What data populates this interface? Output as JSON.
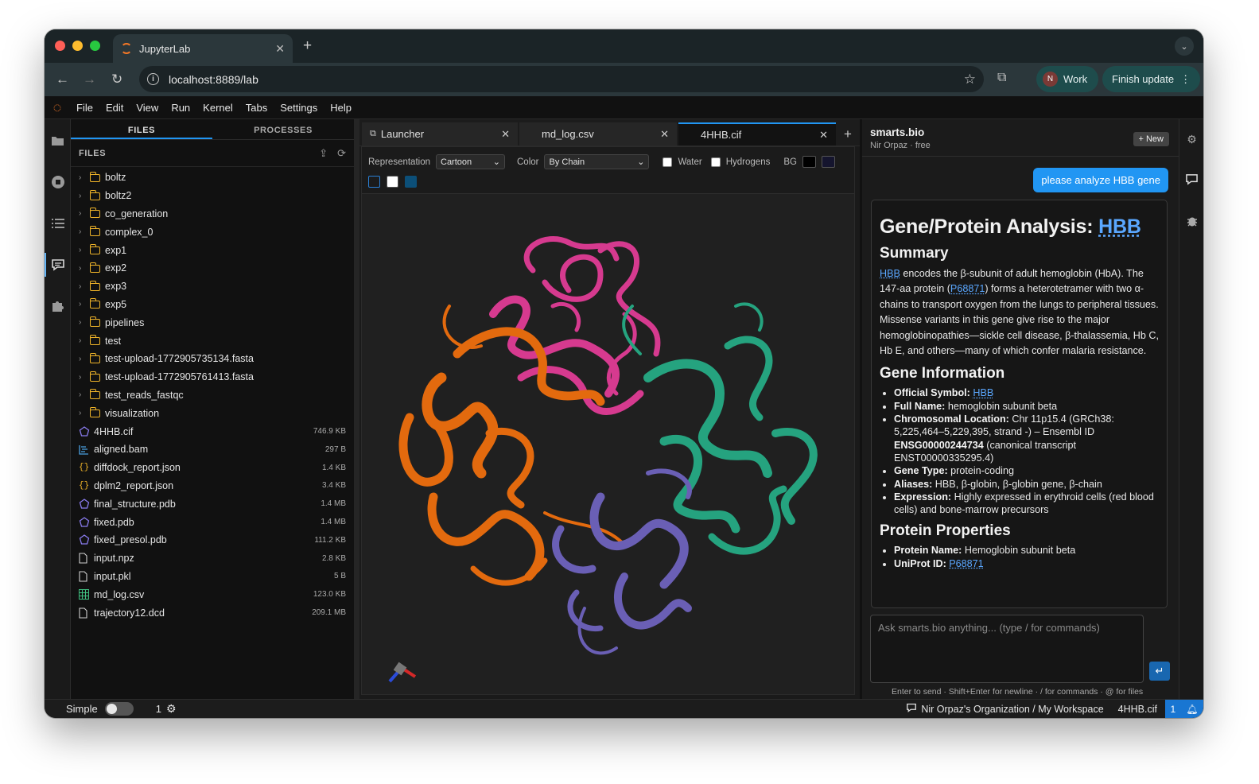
{
  "browser": {
    "tab_title": "JupyterLab",
    "url": "localhost:8889/lab",
    "profile_initial": "N",
    "profile_name": "Work",
    "update_label": "Finish update"
  },
  "menu": [
    "File",
    "Edit",
    "View",
    "Run",
    "Kernel",
    "Tabs",
    "Settings",
    "Help"
  ],
  "file_panel": {
    "tabs": [
      "FILES",
      "PROCESSES"
    ],
    "header": "FILES",
    "folders": [
      "boltz",
      "boltz2",
      "co_generation",
      "complex_0",
      "exp1",
      "exp2",
      "exp3",
      "exp5",
      "pipelines",
      "test",
      "test-upload-1772905735134.fasta",
      "test-upload-1772905761413.fasta",
      "test_reads_fastqc",
      "visualization"
    ],
    "files": [
      {
        "name": "4HHB.cif",
        "size": "746.9 KB",
        "icon": "molecule-icon"
      },
      {
        "name": "aligned.bam",
        "size": "297 B",
        "icon": "alignment-icon"
      },
      {
        "name": "diffdock_report.json",
        "size": "1.4 KB",
        "icon": "json-icon"
      },
      {
        "name": "dplm2_report.json",
        "size": "3.4 KB",
        "icon": "json-icon"
      },
      {
        "name": "final_structure.pdb",
        "size": "1.4 MB",
        "icon": "molecule-icon"
      },
      {
        "name": "fixed.pdb",
        "size": "1.4 MB",
        "icon": "molecule-icon"
      },
      {
        "name": "fixed_presol.pdb",
        "size": "111.2 KB",
        "icon": "molecule-icon"
      },
      {
        "name": "input.npz",
        "size": "2.8 KB",
        "icon": "file-icon"
      },
      {
        "name": "input.pkl",
        "size": "5 B",
        "icon": "file-icon"
      },
      {
        "name": "md_log.csv",
        "size": "123.0 KB",
        "icon": "spreadsheet-icon"
      },
      {
        "name": "trajectory12.dcd",
        "size": "209.1 MB",
        "icon": "file-icon"
      }
    ]
  },
  "doc_tabs": [
    {
      "label": "Launcher",
      "active": false
    },
    {
      "label": "md_log.csv",
      "active": false
    },
    {
      "label": "4HHB.cif",
      "active": true
    }
  ],
  "viewer": {
    "representation_label": "Representation",
    "representation_value": "Cartoon",
    "color_label": "Color",
    "color_value": "By Chain",
    "water_label": "Water",
    "hydrogens_label": "Hydrogens",
    "bg_label": "BG",
    "chain_colors": [
      "#d63a8f",
      "#e36a0e",
      "#25a37f",
      "#6a5fb5"
    ]
  },
  "assistant": {
    "title": "smarts.bio",
    "subtitle": "Nir Orpaz · free",
    "new_label": "+ New",
    "user_message": "please analyze HBB gene",
    "h1_prefix": "Gene/Protein Analysis: ",
    "h1_link": "HBB",
    "summary_heading": "Summary",
    "summary_link": "HBB",
    "summary_part1": " encodes the β-subunit of adult hemoglobin (HbA). The 147-aa protein (",
    "summary_uniprot": "P68871",
    "summary_part2": ") forms a heterotetramer with two α-chains to transport oxygen from the lungs to peripheral tissues. Missense variants in this gene give rise to the major hemoglobinopathies—sickle cell disease, β-thalassemia, Hb C, Hb E, and others—many of which confer malaria resistance.",
    "gene_heading": "Gene Information",
    "gene_items": [
      {
        "label": "Official Symbol:",
        "value": "HBB",
        "link": true
      },
      {
        "label": "Full Name:",
        "value": " hemoglobin subunit beta"
      },
      {
        "label": "Chromosomal Location:",
        "value": " Chr 11p15.4 (GRCh38: 5,225,464–5,229,395, strand -) – Ensembl ID "
      },
      {
        "label": "Gene Type:",
        "value": " protein-coding"
      },
      {
        "label": "Aliases:",
        "value": " HBB, β-globin, β-globin gene, β-chain"
      },
      {
        "label": "Expression:",
        "value": " Highly expressed in erythroid cells (red blood cells) and bone-marrow precursors"
      }
    ],
    "ensembl_id": "ENSG00000244734",
    "ensembl_tail": " (canonical transcript ENST00000335295.4)",
    "protein_heading": "Protein Properties",
    "protein_items": [
      {
        "label": "Protein Name:",
        "value": " Hemoglobin subunit beta"
      },
      {
        "label": "UniProt ID:",
        "value": "P68871",
        "link": true
      }
    ],
    "input_placeholder": "Ask smarts.bio anything... (type / for commands)",
    "hint": "Enter to send · Shift+Enter for newline · / for commands · @ for files"
  },
  "status": {
    "mode": "Simple",
    "count": "1",
    "workspace": "Nir Orpaz's Organization / My Workspace",
    "active_file": "4HHB.cif",
    "notifications": "1"
  }
}
